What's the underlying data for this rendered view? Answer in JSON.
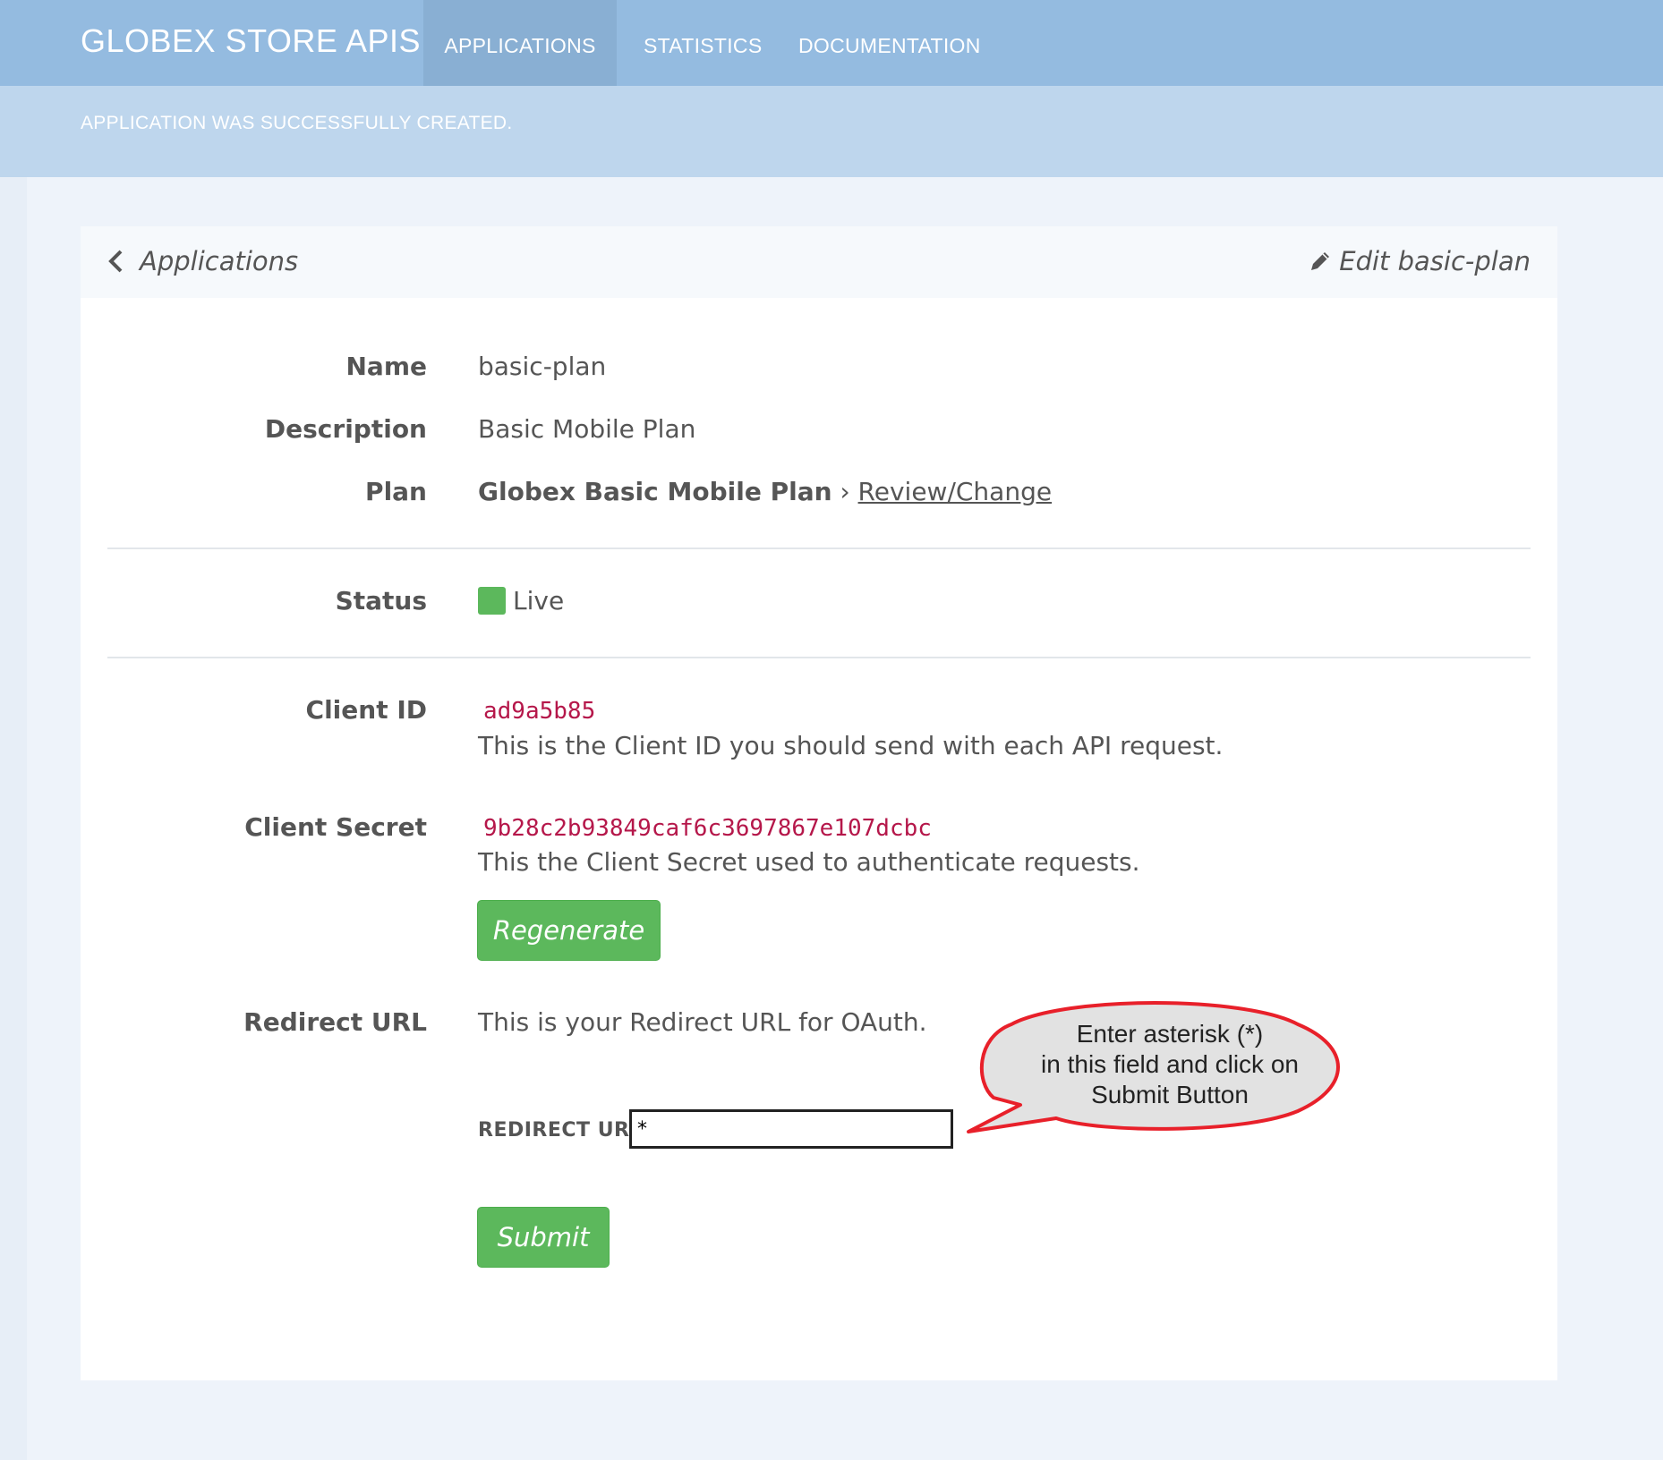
{
  "header": {
    "brand": "GLOBEX STORE APIS",
    "nav": [
      {
        "label": "APPLICATIONS",
        "active": true
      },
      {
        "label": "STATISTICS",
        "active": false
      },
      {
        "label": "DOCUMENTATION",
        "active": false
      }
    ]
  },
  "flash": {
    "message": "APPLICATION WAS SUCCESSFULLY CREATED."
  },
  "card": {
    "back_label": "Applications",
    "edit_label": "Edit basic-plan"
  },
  "fields": {
    "name_label": "Name",
    "name_value": "basic-plan",
    "description_label": "Description",
    "description_value": "Basic Mobile Plan",
    "plan_label": "Plan",
    "plan_value": "Globex Basic Mobile Plan",
    "plan_separator": "›",
    "plan_link": "Review/Change",
    "status_label": "Status",
    "status_value": "Live",
    "status_color": "#5cb85c",
    "client_id_label": "Client ID",
    "client_id_value": "ad9a5b85",
    "client_id_help": "This is the Client ID you should send with each API request.",
    "client_secret_label": "Client Secret",
    "client_secret_value": "9b28c2b93849caf6c3697867e107dcbc",
    "client_secret_help": "This the Client Secret used to authenticate requests.",
    "regenerate_label": "Regenerate",
    "redirect_label": "Redirect URL",
    "redirect_help": "This is your Redirect URL for OAuth.",
    "redirect_input_label": "REDIRECT URL",
    "redirect_input_value": "*",
    "submit_label": "Submit"
  },
  "callout": {
    "lines": [
      "Enter asterisk (*)",
      "in this field and click on",
      "Submit Button"
    ],
    "border_color": "#e8202a",
    "fill_color": "#e2e2e2"
  }
}
